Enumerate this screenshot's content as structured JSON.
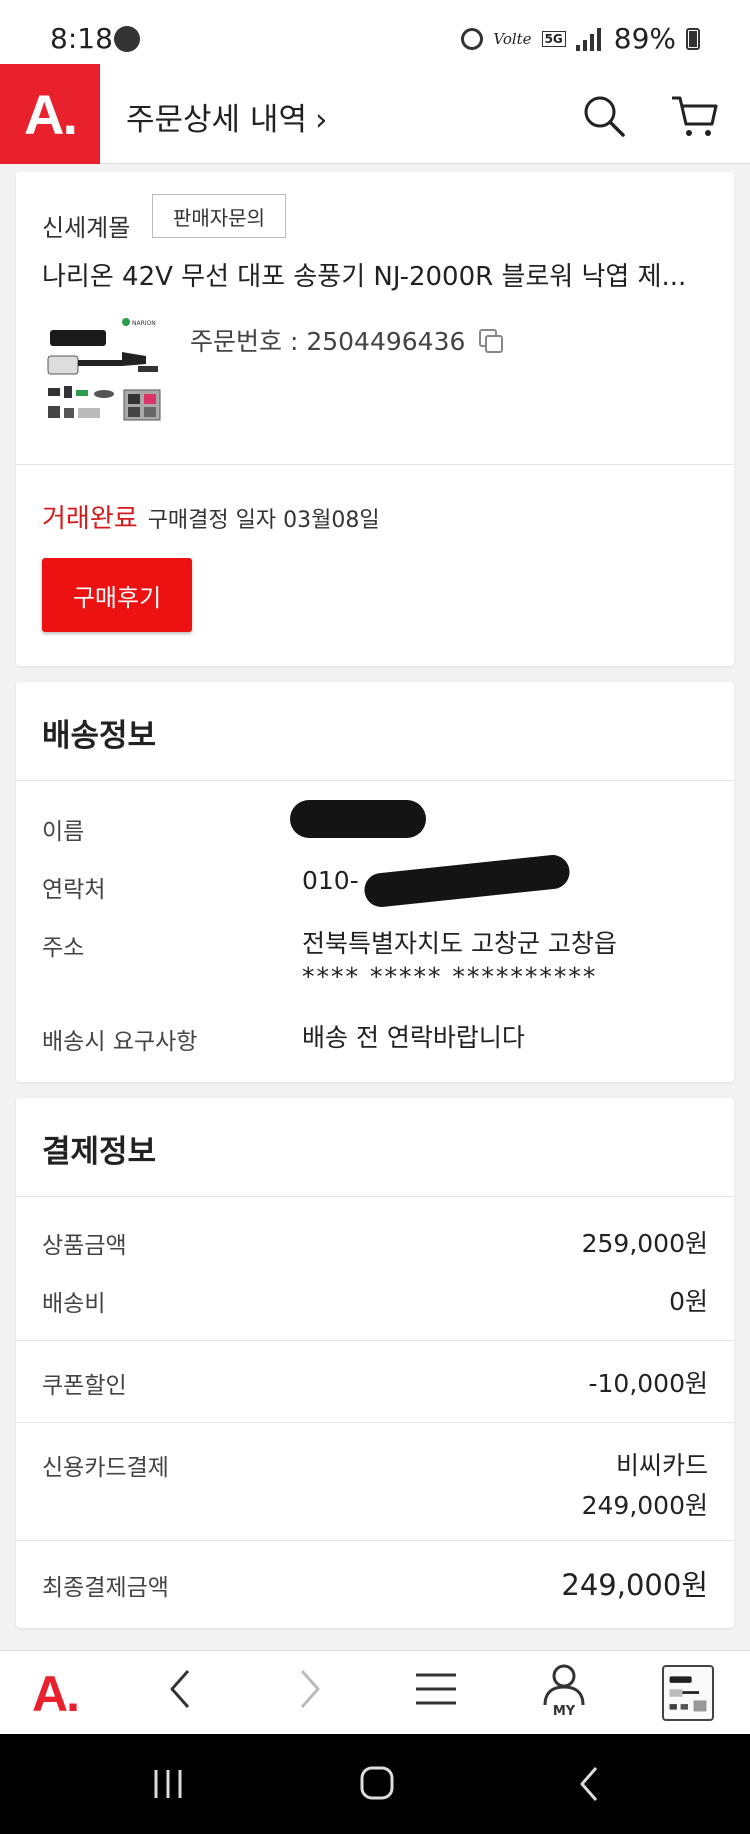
{
  "status_bar": {
    "time": "8:18",
    "network": "5G",
    "volte": "Volte",
    "battery": "89%"
  },
  "header": {
    "logo": "A.",
    "title": "주문상세 내역",
    "chevron": "›",
    "search_icon": "search-icon",
    "cart_icon": "cart-icon"
  },
  "order": {
    "seller": "신세계몰",
    "contact_seller_label": "판매자문의",
    "product_name": "나리온 42V 무선 대포 송풍기 NJ-2000R 블로워 낙엽 제...",
    "product_brand": "NARION",
    "order_number_label": "주문번호 : 2504496436",
    "status_label": "거래완료",
    "purchase_confirm": "구매결정 일자 03월08일",
    "review_button": "구매후기"
  },
  "shipping": {
    "title": "배송정보",
    "rows": [
      {
        "label": "이름",
        "value": ""
      },
      {
        "label": "연락처",
        "value": "010-"
      },
      {
        "label": "주소",
        "value": "전북특별자치도 고창군 고창읍",
        "value2": "**** ***** **********"
      },
      {
        "label": "배송시 요구사항",
        "value": "배송 전 연락바랍니다"
      }
    ]
  },
  "payment": {
    "title": "결제정보",
    "product_amount_label": "상품금액",
    "product_amount": "259,000원",
    "shipping_fee_label": "배송비",
    "shipping_fee": "0원",
    "coupon_label": "쿠폰할인",
    "coupon": "-10,000원",
    "card_label": "신용카드결제",
    "card_name": "비씨카드",
    "card_amount": "249,000원",
    "final_label": "최종결제금액",
    "final_amount": "249,000원"
  },
  "bottom_nav": {
    "logo": "A.",
    "my_label": "MY"
  },
  "colors": {
    "brand": "#e8212d",
    "status_red": "#d41a1a",
    "review_button": "#ee1111"
  }
}
